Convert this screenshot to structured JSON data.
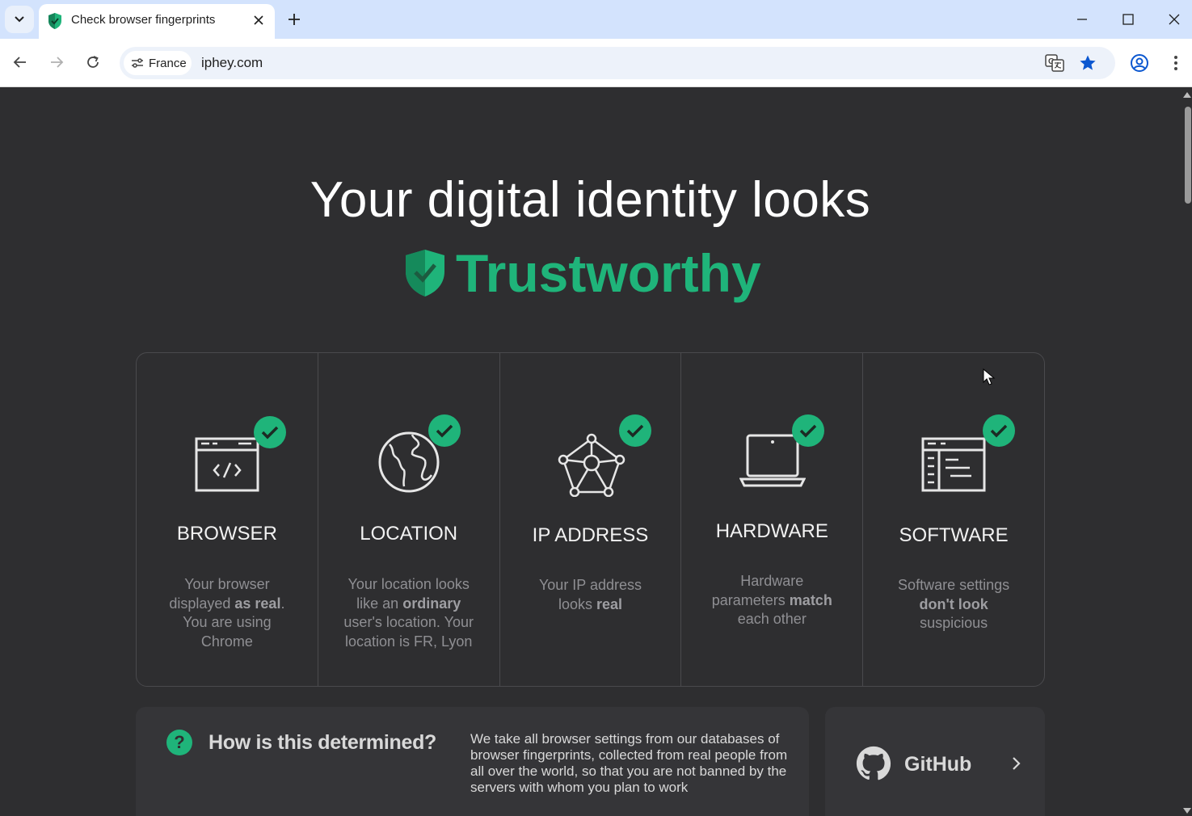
{
  "browser": {
    "tab": {
      "title": "Check browser fingerprints"
    },
    "site_chip": "France",
    "url": "iphey.com"
  },
  "hero": {
    "headline": "Your digital identity looks",
    "verdict": "Trustworthy"
  },
  "cards": [
    {
      "title": "BROWSER",
      "desc_before": "Your browser displayed ",
      "desc_bold": "as real",
      "desc_after": ". You are using Chrome"
    },
    {
      "title": "LOCATION",
      "desc_before": "Your location looks like an ",
      "desc_bold": "ordinary",
      "desc_after": " user's location. Your location is FR, Lyon"
    },
    {
      "title": "IP ADDRESS",
      "desc_before": "Your IP address looks ",
      "desc_bold": "real",
      "desc_after": ""
    },
    {
      "title": "HARDWARE",
      "desc_before": "Hardware parameters ",
      "desc_bold": "match",
      "desc_after": " each other"
    },
    {
      "title": "SOFTWARE",
      "desc_before": "Software settings ",
      "desc_bold": "don't look",
      "desc_after": " suspicious"
    }
  ],
  "info": {
    "question_mark": "?",
    "title": "How is this determined?",
    "text": "We take all browser settings from our databases of browser fingerprints, collected from real people from all over the world, so that you are not banned by the servers with whom you plan to work"
  },
  "github": {
    "label": "GitHub"
  },
  "colors": {
    "accent": "#1fb47a",
    "background": "#2e2e30",
    "tab_strip": "#d3e3fd"
  },
  "icons": [
    "tab-list-icon",
    "shield-favicon-icon",
    "close-icon",
    "plus-icon",
    "minimize-icon",
    "maximize-icon",
    "window-close-icon",
    "back-icon",
    "forward-icon",
    "reload-icon",
    "site-settings-icon",
    "translate-icon",
    "star-icon",
    "profile-icon",
    "kebab-menu-icon",
    "shield-icon",
    "check-icon",
    "browser-window-icon",
    "globe-icon",
    "network-icon",
    "laptop-icon",
    "software-layout-icon",
    "question-icon",
    "github-icon",
    "chevron-right-icon",
    "mouse-cursor-icon"
  ]
}
